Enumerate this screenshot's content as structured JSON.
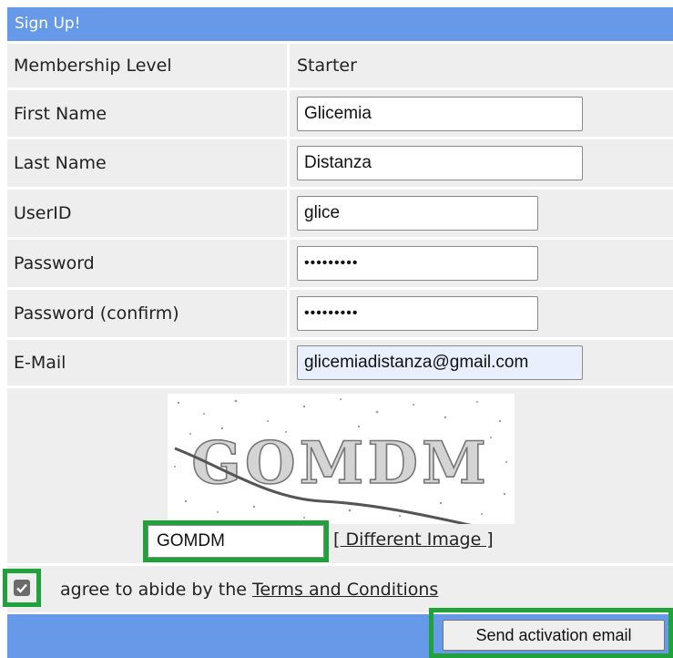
{
  "form": {
    "title": "Sign Up!",
    "fields": [
      {
        "label": "Membership Level",
        "value": "Starter"
      },
      {
        "label": "First Name",
        "value": "Glicemia"
      },
      {
        "label": "Last Name",
        "value": "Distanza"
      },
      {
        "label": "UserID",
        "value": "glice"
      },
      {
        "label": "Password",
        "value": "•••••••••"
      },
      {
        "label": "Password (confirm)",
        "value": "•••••••••"
      },
      {
        "label": "E-Mail",
        "value": "glicemiadistanza@gmail.com"
      }
    ],
    "captcha": {
      "image_text": "GOMDM",
      "input_value": "GOMDM",
      "different_image_label": "[ Different Image ]"
    },
    "terms": {
      "checked": true,
      "prefix": "agree to abide by the ",
      "link": "Terms and Conditions"
    },
    "submit_label": "Send activation email"
  },
  "colors": {
    "header": "#6699e8",
    "row_background": "#eeeeee",
    "highlight": "#1fa23a"
  }
}
